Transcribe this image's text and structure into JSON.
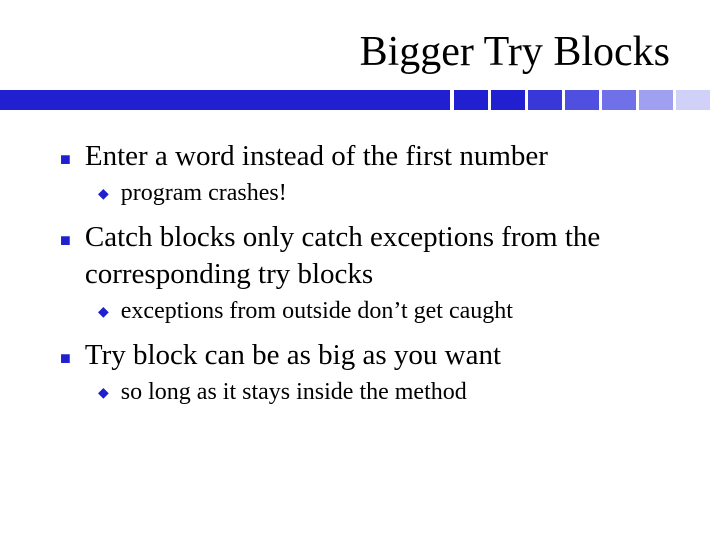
{
  "title": "Bigger Try Blocks",
  "bar": {
    "colors": [
      "#2020d0",
      "#2020d0",
      "#3838d8",
      "#5050e0",
      "#7070e8",
      "#a0a0f0",
      "#d0d0f8"
    ]
  },
  "bullets": [
    {
      "text": "Enter a word instead of the first number",
      "sub": [
        {
          "text": "program crashes!"
        }
      ]
    },
    {
      "text": "Catch blocks only catch exceptions from the corresponding try blocks",
      "sub": [
        {
          "text": "exceptions from outside don’t get caught"
        }
      ]
    },
    {
      "text": "Try block can be as big as you want",
      "sub": [
        {
          "text": "so long as it stays inside the method"
        }
      ]
    }
  ]
}
